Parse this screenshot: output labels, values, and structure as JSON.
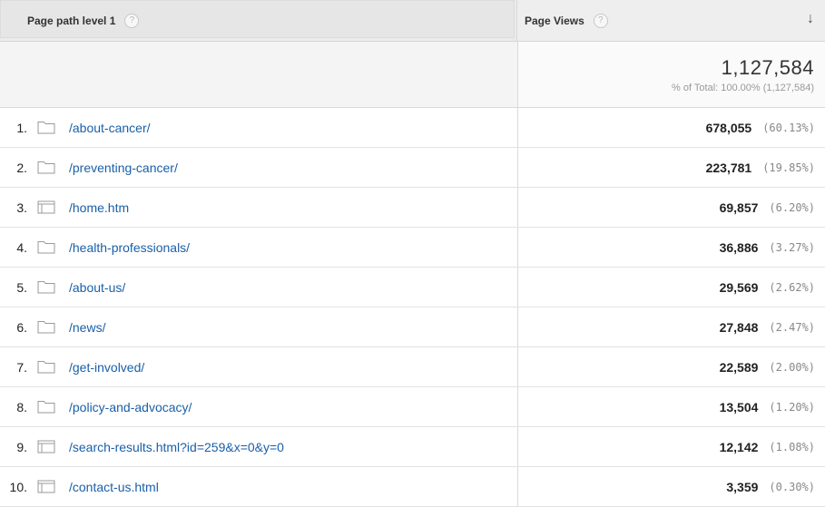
{
  "header": {
    "dimension_label": "Page path level 1",
    "metric_label": "Page Views",
    "help_glyph": "?",
    "sort_glyph": "↓"
  },
  "totals": {
    "value": "1,127,584",
    "sub": "% of Total: 100.00% (1,127,584)"
  },
  "rows": [
    {
      "rank": "1.",
      "icon": "folder-icon",
      "path": "/about-cancer/",
      "views": "678,055",
      "pct": "(60.13%)"
    },
    {
      "rank": "2.",
      "icon": "folder-icon",
      "path": "/preventing-cancer/",
      "views": "223,781",
      "pct": "(19.85%)"
    },
    {
      "rank": "3.",
      "icon": "page-icon",
      "path": "/home.htm",
      "views": "69,857",
      "pct": "(6.20%)"
    },
    {
      "rank": "4.",
      "icon": "folder-icon",
      "path": "/health-professionals/",
      "views": "36,886",
      "pct": "(3.27%)"
    },
    {
      "rank": "5.",
      "icon": "folder-icon",
      "path": "/about-us/",
      "views": "29,569",
      "pct": "(2.62%)"
    },
    {
      "rank": "6.",
      "icon": "folder-icon",
      "path": "/news/",
      "views": "27,848",
      "pct": "(2.47%)"
    },
    {
      "rank": "7.",
      "icon": "folder-icon",
      "path": "/get-involved/",
      "views": "22,589",
      "pct": "(2.00%)"
    },
    {
      "rank": "8.",
      "icon": "folder-icon",
      "path": "/policy-and-advocacy/",
      "views": "13,504",
      "pct": "(1.20%)"
    },
    {
      "rank": "9.",
      "icon": "page-icon",
      "path": "/search-results.html?id=259&x=0&y=0",
      "views": "12,142",
      "pct": "(1.08%)"
    },
    {
      "rank": "10.",
      "icon": "page-icon",
      "path": "/contact-us.html",
      "views": "3,359",
      "pct": "(0.30%)"
    }
  ],
  "colors": {
    "link": "#1a5fa8",
    "header_bg": "#ebebeb"
  }
}
